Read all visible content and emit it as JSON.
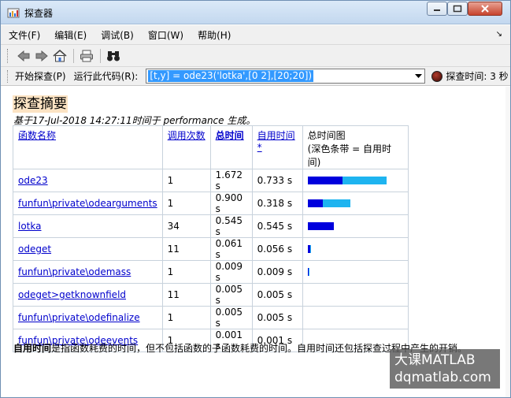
{
  "window": {
    "title": "探查器"
  },
  "menubar": {
    "items": [
      "文件(F)",
      "编辑(E)",
      "调试(B)",
      "窗口(W)",
      "帮助(H)"
    ],
    "dock_glyph": "↘"
  },
  "toolbar": {
    "icons": [
      "back-arrow-icon",
      "forward-arrow-icon",
      "home-icon",
      "print-icon",
      "find-binoculars-icon"
    ]
  },
  "runbar": {
    "start_label": "开始探查(P)",
    "run_code_label": "运行此代码(R):",
    "code_value": "[t,y] = ode23('lotka',[0 2],[20;20])",
    "time_label": "探查时间: 3 秒"
  },
  "summary": {
    "title": "探查摘要",
    "subtitle": "基于17-Jul-2018 14:27:11时间于 performance 生成。",
    "headers": {
      "name": "函数名称",
      "calls": "调用次数",
      "total_time": "总时间",
      "self_time": "自用时间*",
      "chart_line1": "总时间图",
      "chart_line2": "(深色条带 = 自用时间)"
    },
    "rows": [
      {
        "name": "ode23",
        "calls": "1",
        "total": "1.672 s",
        "self": "0.733 s",
        "total_frac": 0.833,
        "self_frac": 0.365
      },
      {
        "name": "funfun\\private\\odearguments",
        "calls": "1",
        "total": "0.900 s",
        "self": "0.318 s",
        "total_frac": 0.448,
        "self_frac": 0.158
      },
      {
        "name": "lotka",
        "calls": "34",
        "total": "0.545 s",
        "self": "0.545 s",
        "total_frac": 0.271,
        "self_frac": 0.271
      },
      {
        "name": "odeget",
        "calls": "11",
        "total": "0.061 s",
        "self": "0.056 s",
        "total_frac": 0.03,
        "self_frac": 0.028
      },
      {
        "name": "funfun\\private\\odemass",
        "calls": "1",
        "total": "0.009 s",
        "self": "0.009 s",
        "total_frac": 0.006,
        "self_frac": 0.006
      },
      {
        "name": "odeget>getknownfield",
        "calls": "11",
        "total": "0.005 s",
        "self": "0.005 s",
        "total_frac": 0,
        "self_frac": 0
      },
      {
        "name": "funfun\\private\\odefinalize",
        "calls": "1",
        "total": "0.005 s",
        "self": "0.005 s",
        "total_frac": 0,
        "self_frac": 0
      },
      {
        "name": "funfun\\private\\odeevents",
        "calls": "1",
        "total": "0.001 s",
        "self": "0.001 s",
        "total_frac": 0,
        "self_frac": 0
      }
    ],
    "note_bold": "自用时间",
    "note_rest": "是指函数耗费的时间，但不包括函数的子函数耗费的时间。自用时间还包括探查过程中产生的开销。"
  },
  "watermark": {
    "line1": "大课MATLAB",
    "line2": "dqmatlab.com"
  },
  "colors": {
    "self_bar": "#0000dd",
    "total_bar": "#1eb4f0",
    "link": "#0000cc",
    "title_highlight": "#fce3c3"
  }
}
